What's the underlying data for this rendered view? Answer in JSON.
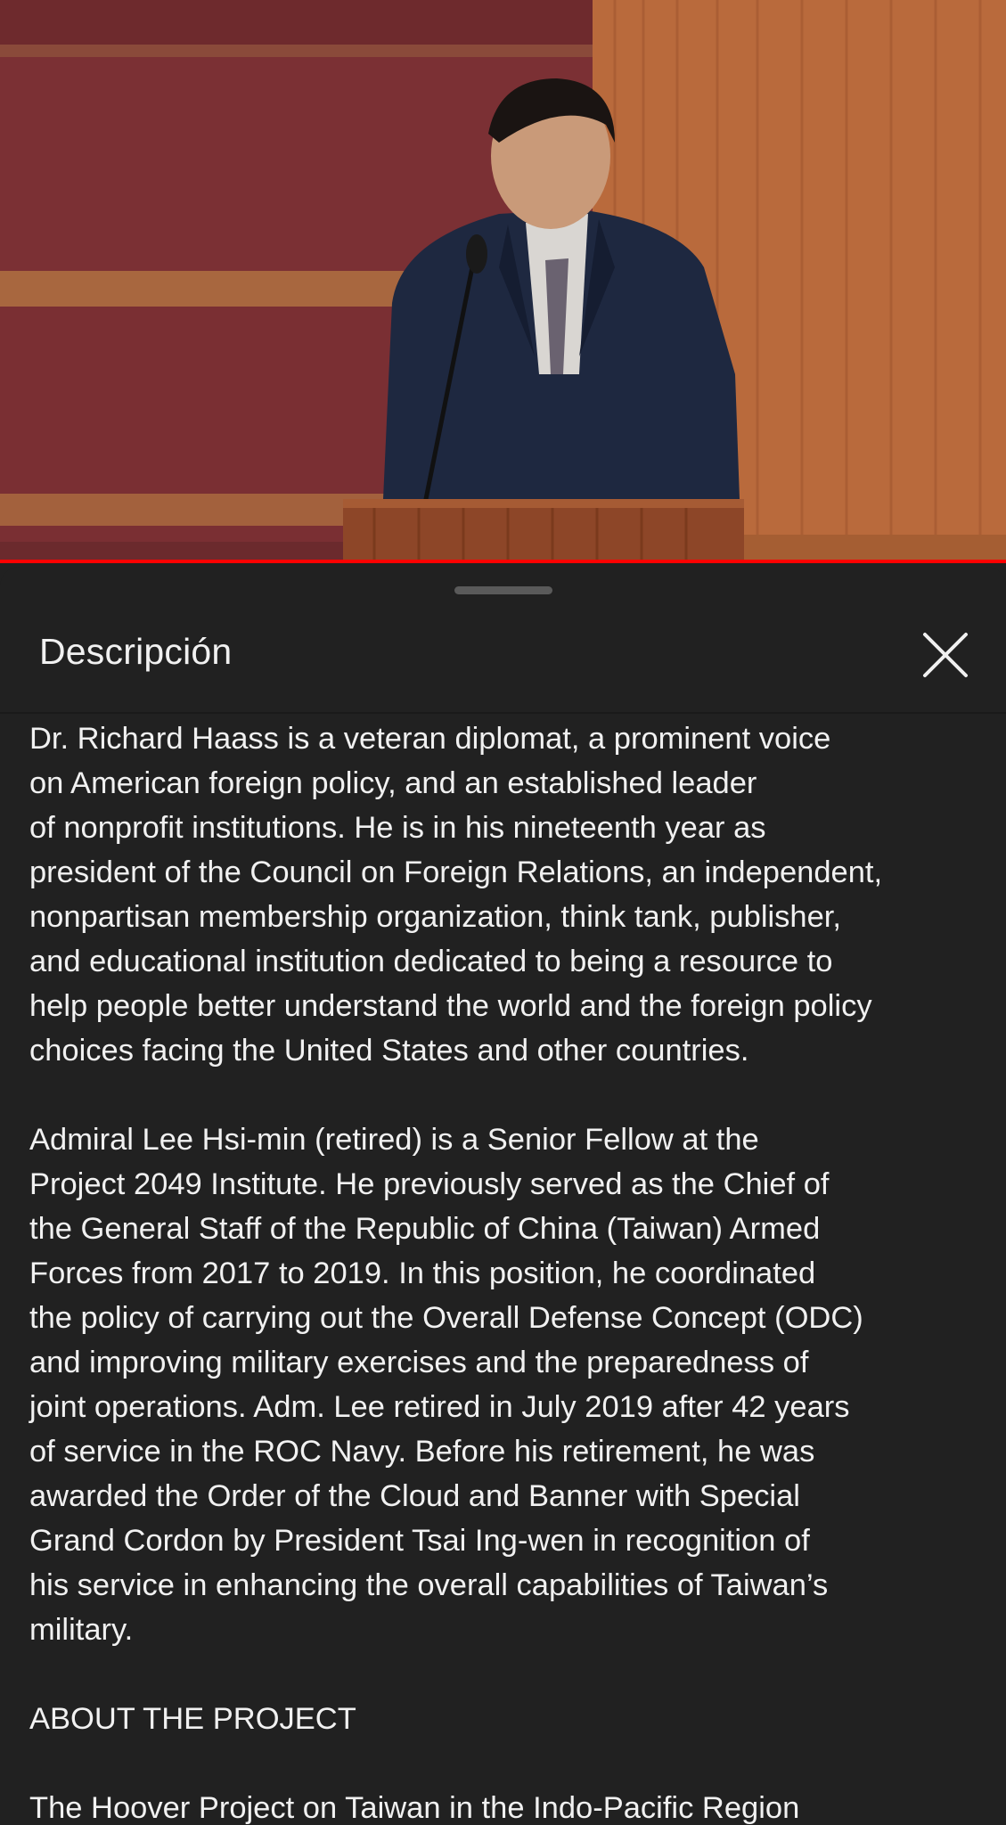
{
  "video": {
    "progress_fraction": 1.0,
    "progress_color": "#ff0000"
  },
  "sheet": {
    "title": "Descripción",
    "close_icon": "close-icon"
  },
  "description": {
    "paragraph1": [
      "Dr. Richard Haass is a veteran diplomat, a prominent voice",
      "on American foreign policy, and an established leader",
      "of nonprofit institutions. He is in his nineteenth year as",
      "president of the Council on Foreign Relations, an independent,",
      "nonpartisan membership organization, think tank, publisher,",
      "and educational institution dedicated to being a resource to",
      "help people better understand the world and the foreign policy",
      "choices facing the United States and other countries."
    ],
    "paragraph2": [
      "Admiral Lee Hsi-min (retired) is a Senior Fellow at the",
      "Project 2049 Institute. He previously served as the Chief of",
      "the General Staff of the Republic of China (Taiwan) Armed",
      "Forces from 2017 to 2019. In this position, he coordinated",
      "the policy of carrying out the Overall Defense Concept (ODC)",
      "and improving military exercises and the preparedness of",
      "joint operations. Adm. Lee retired in July 2019 after 42 years",
      "of service in the ROC Navy. Before his retirement, he was",
      "awarded the Order of the Cloud and Banner with Special",
      "Grand Cordon by President Tsai Ing-wen in recognition of",
      "his service in enhancing the overall capabilities of Taiwan’s",
      "military."
    ],
    "heading": "ABOUT THE PROJECT",
    "paragraph3": [
      "The Hoover Project on Taiwan in the Indo-Pacific Region"
    ]
  }
}
